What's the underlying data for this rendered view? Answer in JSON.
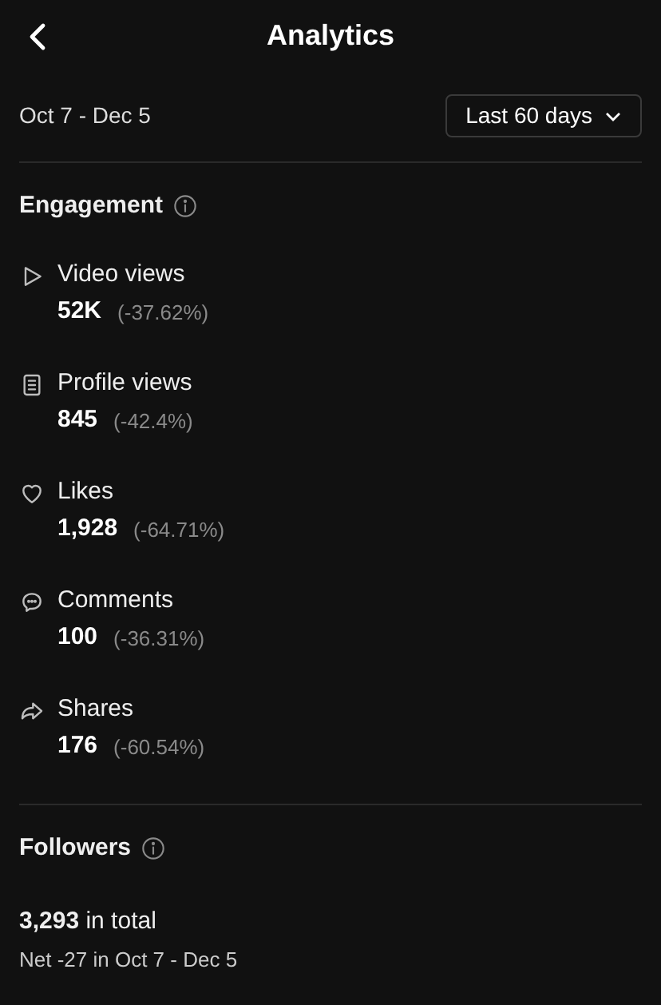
{
  "header": {
    "title": "Analytics"
  },
  "range": {
    "dates": "Oct 7 - Dec 5",
    "selector": "Last 60 days"
  },
  "engagement": {
    "title": "Engagement",
    "metrics": [
      {
        "kind": "play",
        "label": "Video views",
        "value": "52K",
        "change": "(-37.62%)"
      },
      {
        "kind": "document",
        "label": "Profile views",
        "value": "845",
        "change": "(-42.4%)"
      },
      {
        "kind": "heart",
        "label": "Likes",
        "value": "1,928",
        "change": "(-64.71%)"
      },
      {
        "kind": "comment",
        "label": "Comments",
        "value": "100",
        "change": "(-36.31%)"
      },
      {
        "kind": "share",
        "label": "Shares",
        "value": "176",
        "change": "(-60.54%)"
      }
    ]
  },
  "followers": {
    "title": "Followers",
    "total": "**3,293** in total",
    "net": "Net -27 in Oct 7 - Dec 5"
  }
}
